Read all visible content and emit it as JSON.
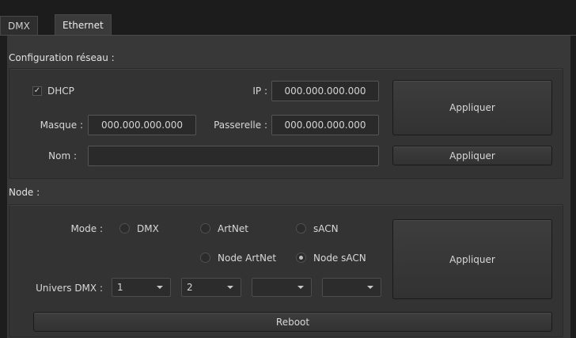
{
  "tabs": [
    {
      "label": "DMX",
      "active": false
    },
    {
      "label": "Ethernet",
      "active": true
    }
  ],
  "network": {
    "section_title": "Configuration réseau :",
    "dhcp": {
      "label": "DHCP",
      "checked": true,
      "check_mark": "✓"
    },
    "ip": {
      "label": "IP :",
      "value": "000.000.000.000"
    },
    "mask": {
      "label": "Masque :",
      "value": "000.000.000.000"
    },
    "gateway": {
      "label": "Passerelle :",
      "value": "000.000.000.000"
    },
    "name": {
      "label": "Nom :",
      "value": ""
    },
    "apply_label": "Appliquer",
    "apply_name_label": "Appliquer"
  },
  "node": {
    "section_title": "Node :",
    "mode_label": "Mode :",
    "modes": [
      {
        "label": "DMX",
        "checked": false
      },
      {
        "label": "ArtNet",
        "checked": false
      },
      {
        "label": "sACN",
        "checked": false
      },
      {
        "label": "Node ArtNet",
        "checked": false
      },
      {
        "label": "Node sACN",
        "checked": true
      }
    ],
    "universe_label": "Univers DMX :",
    "universes": [
      "1",
      "2",
      "",
      ""
    ],
    "apply_label": "Appliquer",
    "reboot_label": "Reboot"
  },
  "colors": {
    "background": "#1d1d1d",
    "panel": "#383838",
    "group": "#333333",
    "field": "#2a2a2a",
    "text": "#dcdcdc"
  }
}
